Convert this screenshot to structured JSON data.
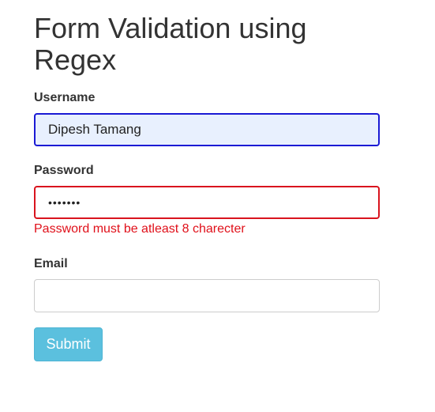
{
  "page": {
    "title": "Form Validation using Regex"
  },
  "form": {
    "username": {
      "label": "Username",
      "value": "Dipesh Tamang"
    },
    "password": {
      "label": "Password",
      "masked_value": "•••••••",
      "error": "Password must be atleast 8 charecter"
    },
    "email": {
      "label": "Email",
      "value": ""
    },
    "submit_label": "Submit"
  },
  "colors": {
    "username_border": "#1a1ad4",
    "username_background": "#e8f0fe",
    "password_border": "#d9141e",
    "error_text": "#e0101a",
    "submit_background": "#5bc0de"
  }
}
